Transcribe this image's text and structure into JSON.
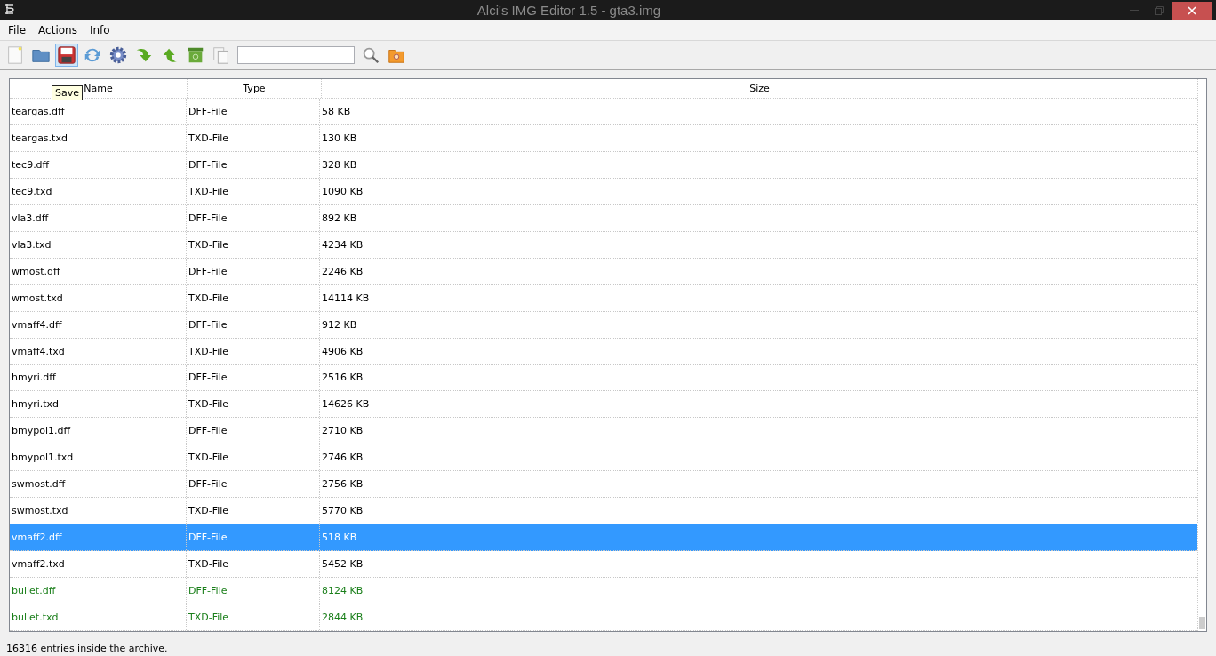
{
  "window": {
    "title": "Alci's IMG Editor 1.5 - gta3.img"
  },
  "menu": [
    "File",
    "Actions",
    "Info"
  ],
  "toolbar": [
    {
      "kind": "new",
      "hovered": false
    },
    {
      "kind": "open",
      "hovered": false
    },
    {
      "kind": "save",
      "hovered": true
    },
    {
      "kind": "refresh",
      "hovered": false
    },
    {
      "kind": "settings",
      "hovered": false
    },
    {
      "kind": "down",
      "hovered": false
    },
    {
      "kind": "up",
      "hovered": false
    },
    {
      "kind": "trash",
      "hovered": false
    },
    {
      "kind": "copy",
      "hovered": false
    },
    {
      "kind": "field"
    },
    {
      "kind": "search",
      "hovered": false
    },
    {
      "kind": "folder-search",
      "hovered": false
    }
  ],
  "tooltip": "Save",
  "table": {
    "columns": [
      "Name",
      "Type",
      "Size"
    ],
    "rows": [
      {
        "cells": [
          "teargas.dff",
          "DFF-File",
          "58 KB"
        ],
        "selected": false,
        "added": false
      },
      {
        "cells": [
          "teargas.txd",
          "TXD-File",
          "130 KB"
        ],
        "selected": false,
        "added": false
      },
      {
        "cells": [
          "tec9.dff",
          "DFF-File",
          "328 KB"
        ],
        "selected": false,
        "added": false
      },
      {
        "cells": [
          "tec9.txd",
          "TXD-File",
          "1090 KB"
        ],
        "selected": false,
        "added": false
      },
      {
        "cells": [
          "vla3.dff",
          "DFF-File",
          "892 KB"
        ],
        "selected": false,
        "added": false
      },
      {
        "cells": [
          "vla3.txd",
          "TXD-File",
          "4234 KB"
        ],
        "selected": false,
        "added": false
      },
      {
        "cells": [
          "wmost.dff",
          "DFF-File",
          "2246 KB"
        ],
        "selected": false,
        "added": false
      },
      {
        "cells": [
          "wmost.txd",
          "TXD-File",
          "14114 KB"
        ],
        "selected": false,
        "added": false
      },
      {
        "cells": [
          "vmaff4.dff",
          "DFF-File",
          "912 KB"
        ],
        "selected": false,
        "added": false
      },
      {
        "cells": [
          "vmaff4.txd",
          "TXD-File",
          "4906 KB"
        ],
        "selected": false,
        "added": false
      },
      {
        "cells": [
          "hmyri.dff",
          "DFF-File",
          "2516 KB"
        ],
        "selected": false,
        "added": false
      },
      {
        "cells": [
          "hmyri.txd",
          "TXD-File",
          "14626 KB"
        ],
        "selected": false,
        "added": false
      },
      {
        "cells": [
          "bmypol1.dff",
          "DFF-File",
          "2710 KB"
        ],
        "selected": false,
        "added": false
      },
      {
        "cells": [
          "bmypol1.txd",
          "TXD-File",
          "2746 KB"
        ],
        "selected": false,
        "added": false
      },
      {
        "cells": [
          "swmost.dff",
          "DFF-File",
          "2756 KB"
        ],
        "selected": false,
        "added": false
      },
      {
        "cells": [
          "swmost.txd",
          "TXD-File",
          "5770 KB"
        ],
        "selected": false,
        "added": false
      },
      {
        "cells": [
          "vmaff2.dff",
          "DFF-File",
          "518 KB"
        ],
        "selected": true,
        "added": false
      },
      {
        "cells": [
          "vmaff2.txd",
          "TXD-File",
          "5452 KB"
        ],
        "selected": false,
        "added": false
      },
      {
        "cells": [
          "bullet.dff",
          "DFF-File",
          "8124 KB"
        ],
        "selected": false,
        "added": true
      },
      {
        "cells": [
          "bullet.txd",
          "TXD-File",
          "2844 KB"
        ],
        "selected": false,
        "added": true
      }
    ]
  },
  "status_bar": "16316 entries inside the archive."
}
